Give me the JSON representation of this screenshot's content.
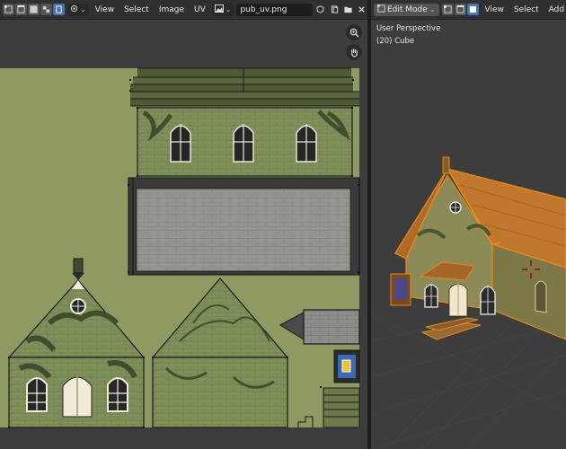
{
  "uv_editor": {
    "menu": [
      "View",
      "Select",
      "Image",
      "UV"
    ],
    "image_name": "pub_uv.png",
    "icons": [
      "vertex-select-icon",
      "edge-select-icon",
      "face-select-icon",
      "island-select-icon",
      "sticky-select-icon",
      "uv-sync-icon",
      "image-browse-icon",
      "fake-user-icon",
      "new-image-icon",
      "open-image-icon",
      "unlink-icon",
      "zoom-icon",
      "hand-icon"
    ]
  },
  "viewport": {
    "mode": "Edit Mode",
    "menu": [
      "View",
      "Select",
      "Add"
    ],
    "view_name": "User Perspective",
    "object_name": "(20) Cube"
  },
  "colors": {
    "uv_background": "#8f9a62",
    "editor_background": "#3d3d3d",
    "header": "#303030",
    "accent": "#4772b3",
    "selection_orange": "#e8891a"
  }
}
